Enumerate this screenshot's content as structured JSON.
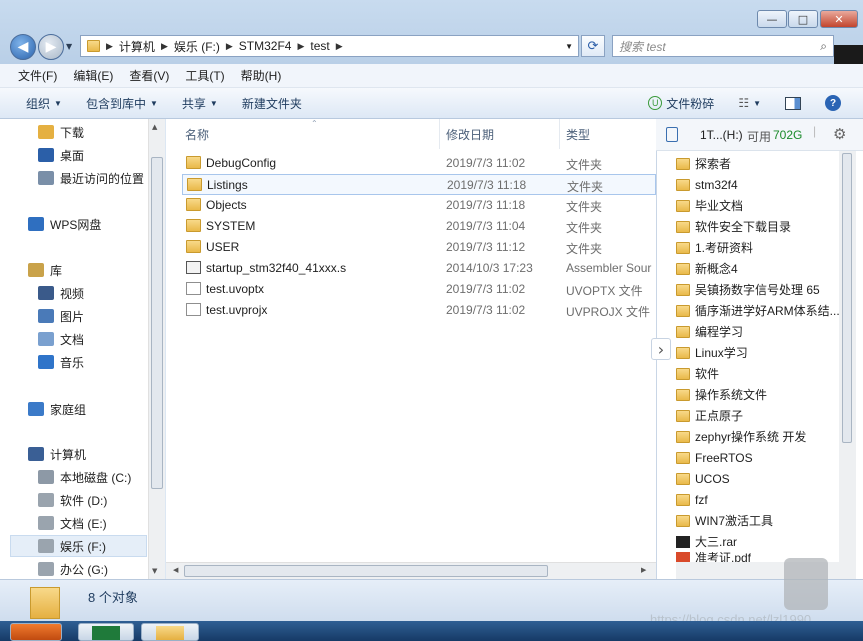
{
  "window": {
    "minimize": "—",
    "maximize": "□",
    "close": "✕"
  },
  "address": {
    "crumbs": [
      "计算机",
      "娱乐 (F:)",
      "STM32F4",
      "test"
    ],
    "search_placeholder": "搜索 test"
  },
  "menu": [
    "文件(F)",
    "编辑(E)",
    "查看(V)",
    "工具(T)",
    "帮助(H)"
  ],
  "toolbar": {
    "organize": "组织",
    "include": "包含到库中",
    "share": "共享",
    "new_folder": "新建文件夹",
    "plugin": "文件粉碎"
  },
  "nav": [
    {
      "label": "下载",
      "icon": "download-folder-icon"
    },
    {
      "label": "桌面",
      "icon": "desktop-icon"
    },
    {
      "label": "最近访问的位置",
      "icon": "recent-places-icon"
    },
    {
      "label": "WPS网盘",
      "icon": "wps-cloud-icon"
    },
    {
      "label": "库",
      "icon": "library-icon"
    },
    {
      "label": "视频",
      "icon": "video-library-icon"
    },
    {
      "label": "图片",
      "icon": "picture-library-icon"
    },
    {
      "label": "文档",
      "icon": "document-library-icon"
    },
    {
      "label": "音乐",
      "icon": "music-library-icon"
    },
    {
      "label": "家庭组",
      "icon": "homegroup-icon"
    },
    {
      "label": "计算机",
      "icon": "computer-icon"
    },
    {
      "label": "本地磁盘 (C:)",
      "icon": "system-drive-icon"
    },
    {
      "label": "软件 (D:)",
      "icon": "drive-icon"
    },
    {
      "label": "文档 (E:)",
      "icon": "drive-icon"
    },
    {
      "label": "娱乐 (F:)",
      "icon": "drive-icon"
    },
    {
      "label": "办公 (G:)",
      "icon": "drive-icon"
    }
  ],
  "columns": {
    "name": "名称",
    "date": "修改日期",
    "type": "类型"
  },
  "files": [
    {
      "name": "DebugConfig",
      "date": "2019/7/3 11:02",
      "type": "文件夹",
      "kind": "folder"
    },
    {
      "name": "Listings",
      "date": "2019/7/3 11:18",
      "type": "文件夹",
      "kind": "folder"
    },
    {
      "name": "Objects",
      "date": "2019/7/3 11:18",
      "type": "文件夹",
      "kind": "folder"
    },
    {
      "name": "SYSTEM",
      "date": "2019/7/3 11:04",
      "type": "文件夹",
      "kind": "folder"
    },
    {
      "name": "USER",
      "date": "2019/7/3 11:12",
      "type": "文件夹",
      "kind": "folder"
    },
    {
      "name": "startup_stm32f40_41xxx.s",
      "date": "2014/10/3 17:23",
      "type": "Assembler Sour",
      "kind": "asm"
    },
    {
      "name": "test.uvoptx",
      "date": "2019/7/3 11:02",
      "type": "UVOPTX 文件",
      "kind": "file"
    },
    {
      "name": "test.uvprojx",
      "date": "2019/7/3 11:02",
      "type": "UVPROJX 文件",
      "kind": "file"
    }
  ],
  "right_pane": {
    "drive": "1T...(H:)",
    "free_label": "可用",
    "free_value": "702G",
    "items": [
      {
        "label": "探索者",
        "kind": "folder"
      },
      {
        "label": "stm32f4",
        "kind": "folder"
      },
      {
        "label": "毕业文档",
        "kind": "folder"
      },
      {
        "label": "软件安全下载目录",
        "kind": "folder"
      },
      {
        "label": "1.考研资料",
        "kind": "folder"
      },
      {
        "label": "新概念4",
        "kind": "folder"
      },
      {
        "label": "吴镇扬数字信号处理 65",
        "kind": "folder"
      },
      {
        "label": "循序渐进学好ARM体系结...",
        "kind": "folder"
      },
      {
        "label": "编程学习",
        "kind": "folder"
      },
      {
        "label": "Linux学习",
        "kind": "folder"
      },
      {
        "label": "软件",
        "kind": "folder"
      },
      {
        "label": "操作系统文件",
        "kind": "folder"
      },
      {
        "label": "正点原子",
        "kind": "folder"
      },
      {
        "label": "zephyr操作系统 开发",
        "kind": "folder"
      },
      {
        "label": "FreeRTOS",
        "kind": "folder"
      },
      {
        "label": "UCOS",
        "kind": "folder"
      },
      {
        "label": "fzf",
        "kind": "folder"
      },
      {
        "label": "WIN7激活工具",
        "kind": "folder"
      },
      {
        "label": "大三.rar",
        "kind": "archive"
      },
      {
        "label": "准考证.pdf",
        "kind": "pdf"
      }
    ]
  },
  "status": {
    "count": "8 个对象"
  },
  "watermark": "https://blog.csdn.net/lzl1990"
}
